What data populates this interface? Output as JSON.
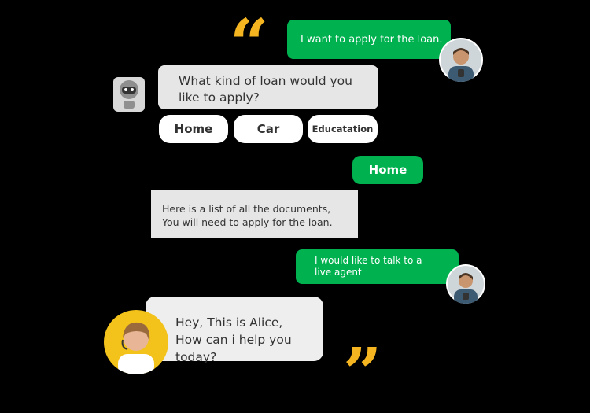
{
  "colors": {
    "accent_green": "#00b14f",
    "quote_yellow": "#f5b521",
    "bubble_gray": "#e6e6e6",
    "background": "#000000"
  },
  "icons": {
    "open_quote": "open-quote-icon",
    "close_quote": "close-quote-icon",
    "bot": "robot-icon"
  },
  "quotes": {
    "open": "“",
    "close": "”"
  },
  "chat": {
    "user_msg_1": "I want to apply for the loan.",
    "bot_question": "What kind of loan would you like to apply?",
    "options": [
      "Home",
      "Car",
      "Educatation"
    ],
    "user_choice": "Home",
    "bot_info": "Here is a list of all the documents, You will need to apply for the loan.",
    "user_msg_2": "I would like to talk to a live agent",
    "agent_msg": "Hey, This is Alice, How can i help you today?"
  }
}
